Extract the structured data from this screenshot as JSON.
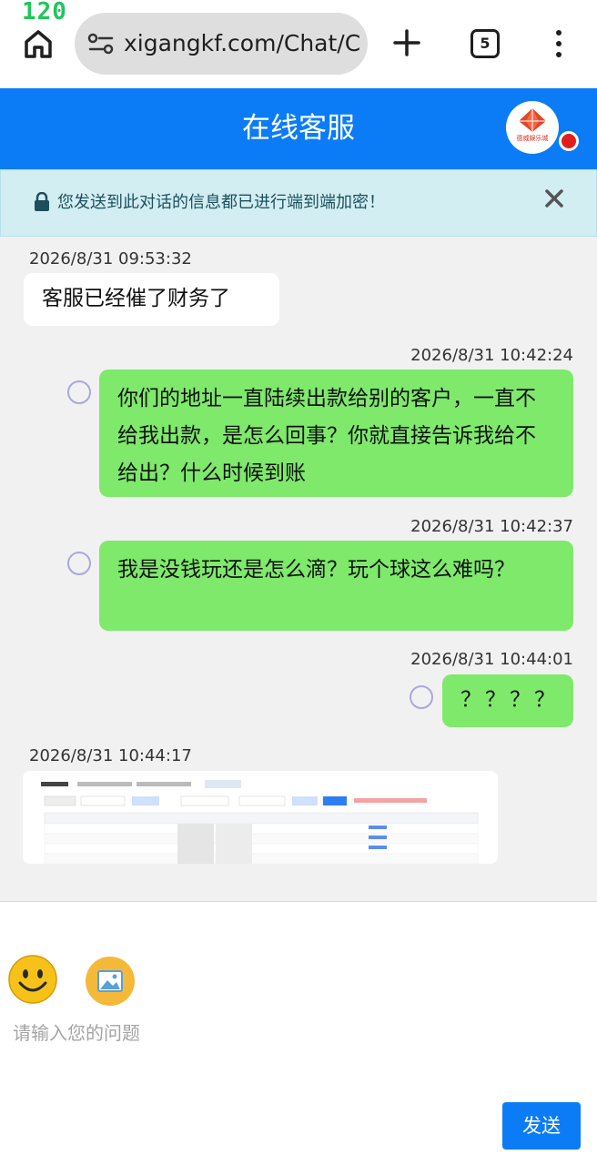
{
  "status_bar": {
    "left_number": "120"
  },
  "browser": {
    "url": "xigangkf.com/Chat/C",
    "tab_count": "5"
  },
  "header": {
    "title": "在线客服",
    "logo_text": "德威娱乐城"
  },
  "banner": {
    "text": "您发送到此对话的信息都已进行端到端加密！"
  },
  "messages": [
    {
      "timestamp": "2026/8/31 09:53:32",
      "text": "客服已经催了财务了",
      "from": "agent"
    },
    {
      "timestamp": "2026/8/31 10:42:24",
      "text": "你们的地址一直陆续出款给别的客户，一直不给我出款，是怎么回事？你就直接告诉我给不给出？什么时候到账",
      "from": "user"
    },
    {
      "timestamp": "2026/8/31 10:42:37",
      "text": "我是没钱玩还是怎么滴？玩个球这么难吗？",
      "from": "user"
    },
    {
      "timestamp": "2026/8/31 10:44:01",
      "text": "？？？？",
      "from": "user"
    },
    {
      "timestamp": "2026/8/31 10:44:17",
      "type": "image",
      "from": "agent"
    }
  ],
  "composer": {
    "placeholder": "请输入您的问题",
    "send_label": "发送"
  },
  "colors": {
    "header_blue": "#0b7cf6",
    "user_bubble": "#7ee96b",
    "chat_bg": "#f1f1f1",
    "banner_bg": "#d2eef3"
  }
}
